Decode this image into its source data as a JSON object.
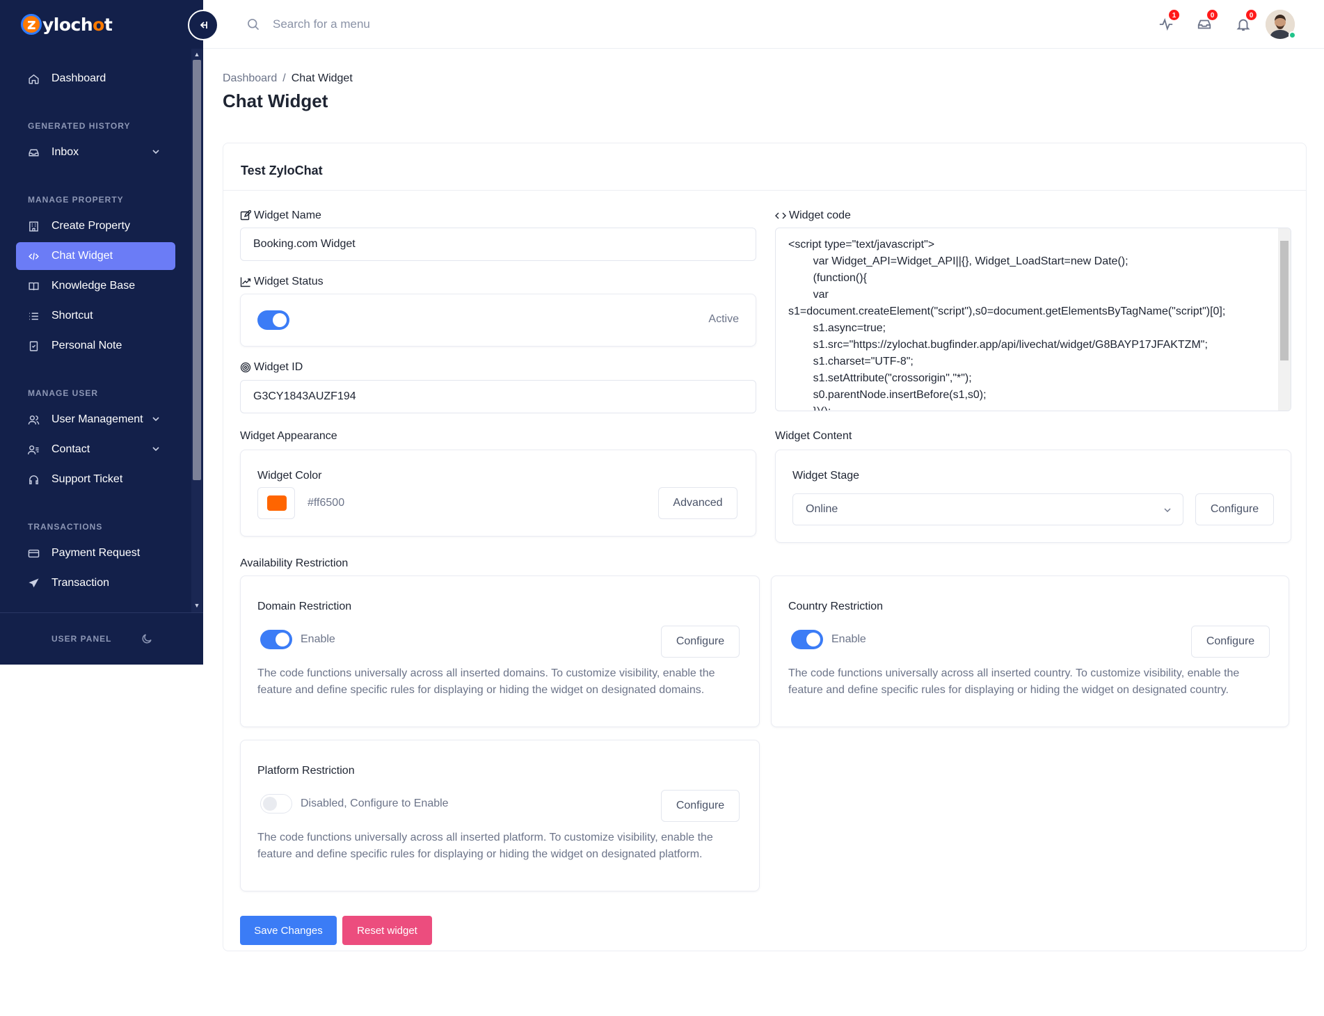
{
  "brand": {
    "name_prefix": "ylo",
    "name_c": "ch",
    "name_o": "o",
    "name_suffix": "t",
    "z": "z"
  },
  "sidebar": {
    "items": {
      "dashboard": "Dashboard",
      "inbox": "Inbox",
      "create_property": "Create Property",
      "chat_widget": "Chat Widget",
      "knowledge_base": "Knowledge Base",
      "shortcut": "Shortcut",
      "personal_note": "Personal Note",
      "user_management": "User Management",
      "contact": "Contact",
      "support_ticket": "Support Ticket",
      "payment_request": "Payment Request",
      "transaction": "Transaction"
    },
    "sections": {
      "generated_history": "Generated History",
      "manage_property": "Manage Property",
      "manage_user": "Manage User",
      "transactions": "Transactions"
    },
    "footer_label": "USER PANEL"
  },
  "topbar": {
    "search_placeholder": "Search for a menu",
    "badges": {
      "activity": "1",
      "inbox": "0",
      "notifications": "0"
    }
  },
  "breadcrumb": {
    "root": "Dashboard",
    "separator": "/",
    "current": "Chat Widget"
  },
  "page_title": "Chat Widget",
  "card": {
    "title": "Test ZyloChat",
    "widget_name_label": "Widget Name",
    "widget_name_value": "Booking.com Widget",
    "widget_status_label": "Widget Status",
    "widget_status_value": "Active",
    "widget_id_label": "Widget ID",
    "widget_id_value": "G3CY1843AUZF194",
    "widget_code_label": "Widget code",
    "widget_code_lines": [
      "<script type=\"text/javascript\">",
      "        var Widget_API=Widget_API||{}, Widget_LoadStart=new Date();",
      "        (function(){",
      "        var",
      "s1=document.createElement(\"script\"),s0=document.getElementsByTagName(\"script\")[0];",
      "        s1.async=true;",
      "        s1.src=\"https://zylochat.bugfinder.app/api/livechat/widget/G8BAYP17JFAKTZM\";",
      "        s1.charset=\"UTF-8\";",
      "        s1.setAttribute(\"crossorigin\",\"*\");",
      "        s0.parentNode.insertBefore(s1,s0);",
      "        })();"
    ],
    "appearance": {
      "section_label": "Widget Appearance",
      "color_label": "Widget Color",
      "color_value": "#ff6500",
      "advanced_label": "Advanced"
    },
    "content": {
      "section_label": "Widget Content",
      "stage_label": "Widget Stage",
      "stage_value": "Online",
      "configure_label": "Configure"
    },
    "availability_label": "Availability Restriction",
    "domain": {
      "title": "Domain Restriction",
      "status": "Enable",
      "configure": "Configure",
      "description": "The code functions universally across all inserted domains. To customize visibility, enable the feature and define specific rules for displaying or hiding the widget on designated domains."
    },
    "country": {
      "title": "Country Restriction",
      "status": "Enable",
      "configure": "Configure",
      "description": "The code functions universally across all inserted country. To customize visibility, enable the feature and define specific rules for displaying or hiding the widget on designated country."
    },
    "platform": {
      "title": "Platform Restriction",
      "status": "Disabled, Configure to Enable",
      "configure": "Configure",
      "description": "The code functions universally across all inserted platform. To customize visibility, enable the feature and define specific rules for displaying or hiding the widget on designated platform."
    },
    "save_label": "Save Changes",
    "reset_label": "Reset widget"
  },
  "colors": {
    "sidebar_bg": "#13204a",
    "active_item": "#6b7cf6",
    "primary": "#3b7cf6",
    "danger": "#ec4d7e",
    "widget_color": "#ff6500"
  }
}
